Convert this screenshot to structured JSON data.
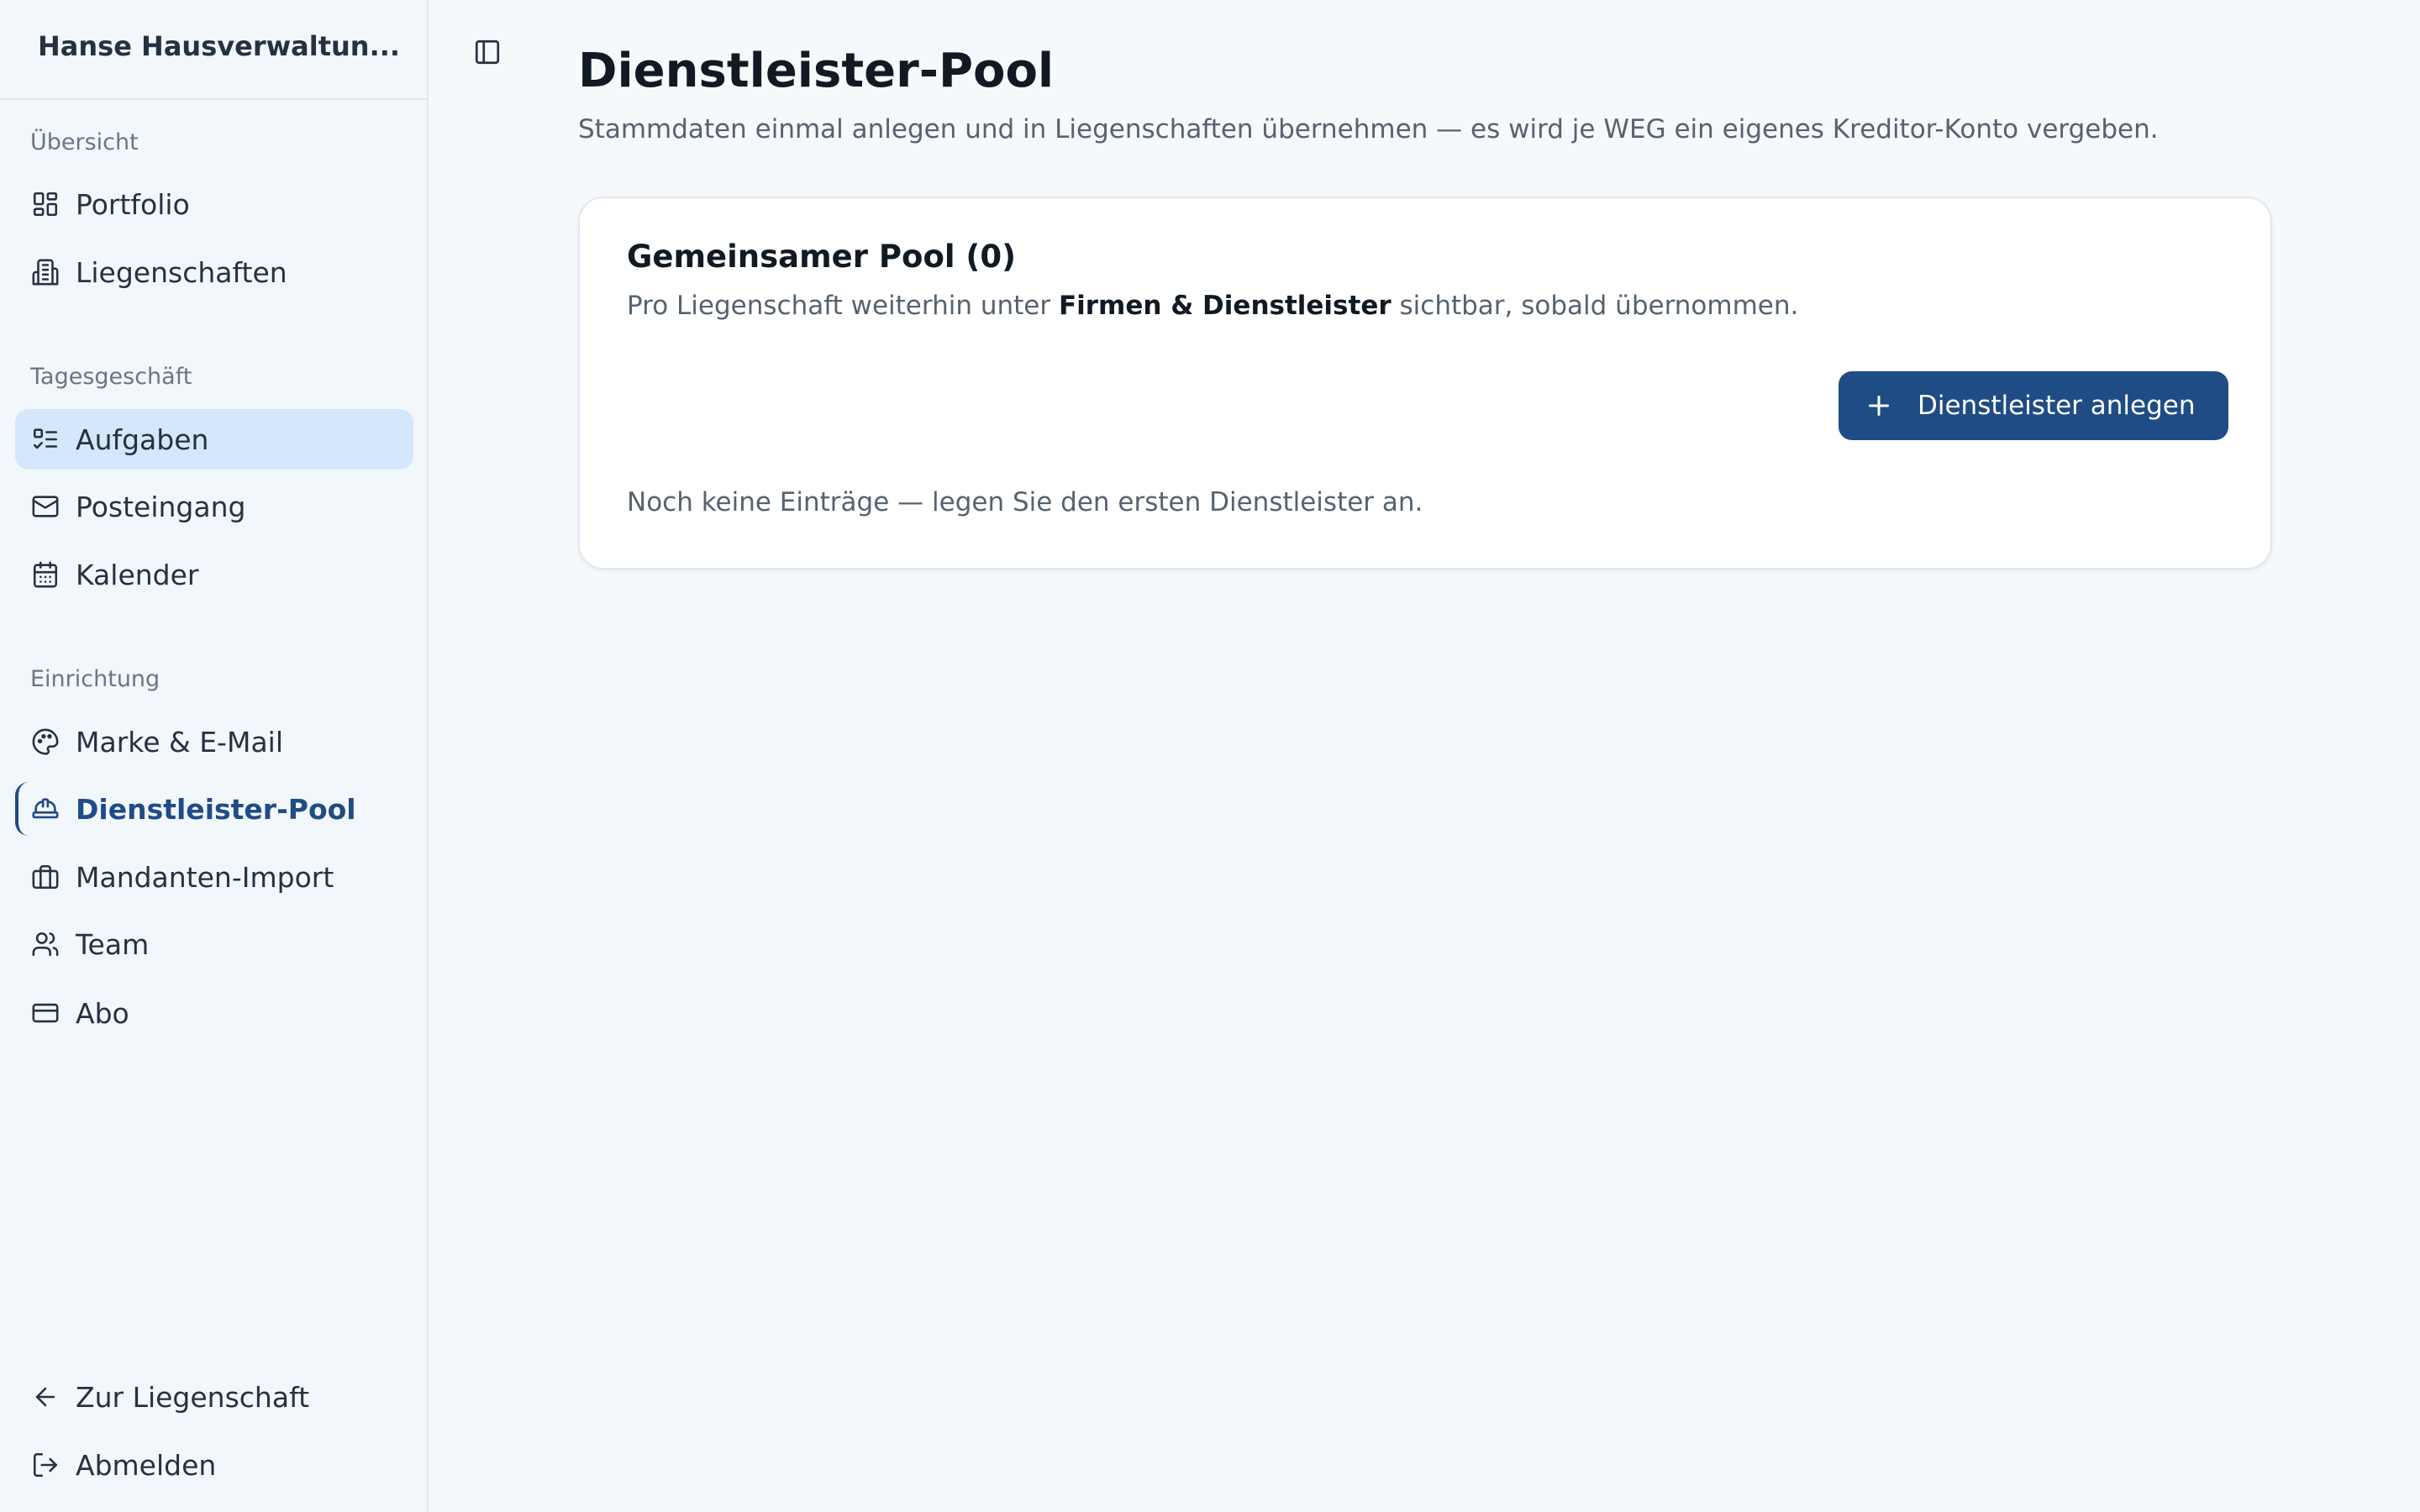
{
  "sidebar": {
    "brand": "Hanse Hausverwaltun...",
    "sections": [
      {
        "label": "Übersicht"
      },
      {
        "label": "Tagesgeschäft"
      },
      {
        "label": "Einrichtung"
      }
    ],
    "items": [
      {
        "label": "Portfolio",
        "icon": "grid-icon"
      },
      {
        "label": "Liegenschaften",
        "icon": "building-icon"
      },
      {
        "label": "Aufgaben",
        "icon": "checklist-icon"
      },
      {
        "label": "Posteingang",
        "icon": "mail-icon"
      },
      {
        "label": "Kalender",
        "icon": "calendar-icon"
      },
      {
        "label": "Marke & E-Mail",
        "icon": "palette-icon"
      },
      {
        "label": "Dienstleister-Pool",
        "icon": "hardhat-icon"
      },
      {
        "label": "Mandanten-Import",
        "icon": "briefcase-icon"
      },
      {
        "label": "Team",
        "icon": "users-icon"
      },
      {
        "label": "Abo",
        "icon": "credit-card-icon"
      },
      {
        "label": "Zur Liegenschaft",
        "icon": "arrow-left-icon"
      },
      {
        "label": "Abmelden",
        "icon": "logout-icon"
      }
    ],
    "active_item": "Dienstleister-Pool",
    "hover_item": "Aufgaben"
  },
  "header": {
    "title": "Dienstleister-Pool",
    "subtitle": "Stammdaten einmal anlegen und in Liegenschaften übernehmen — es wird je WEG ein eigenes Kreditor-Konto vergeben."
  },
  "pool_card": {
    "title": "Gemeinsamer Pool (0)",
    "desc_prefix": "Pro Liegenschaft weiterhin unter ",
    "desc_bold": "Firmen & Dienstleister",
    "desc_suffix": " sichtbar, sobald übernommen.",
    "add_button_label": "Dienstleister anlegen",
    "empty_text": "Noch keine Einträge — legen Sie den ersten Dienstleister an."
  },
  "colors": {
    "accent": "#1f4c85",
    "active_bg": "#d4e7fb",
    "sidebar_bg": "#f2f7fc",
    "page_bg": "#f5f9fc"
  }
}
